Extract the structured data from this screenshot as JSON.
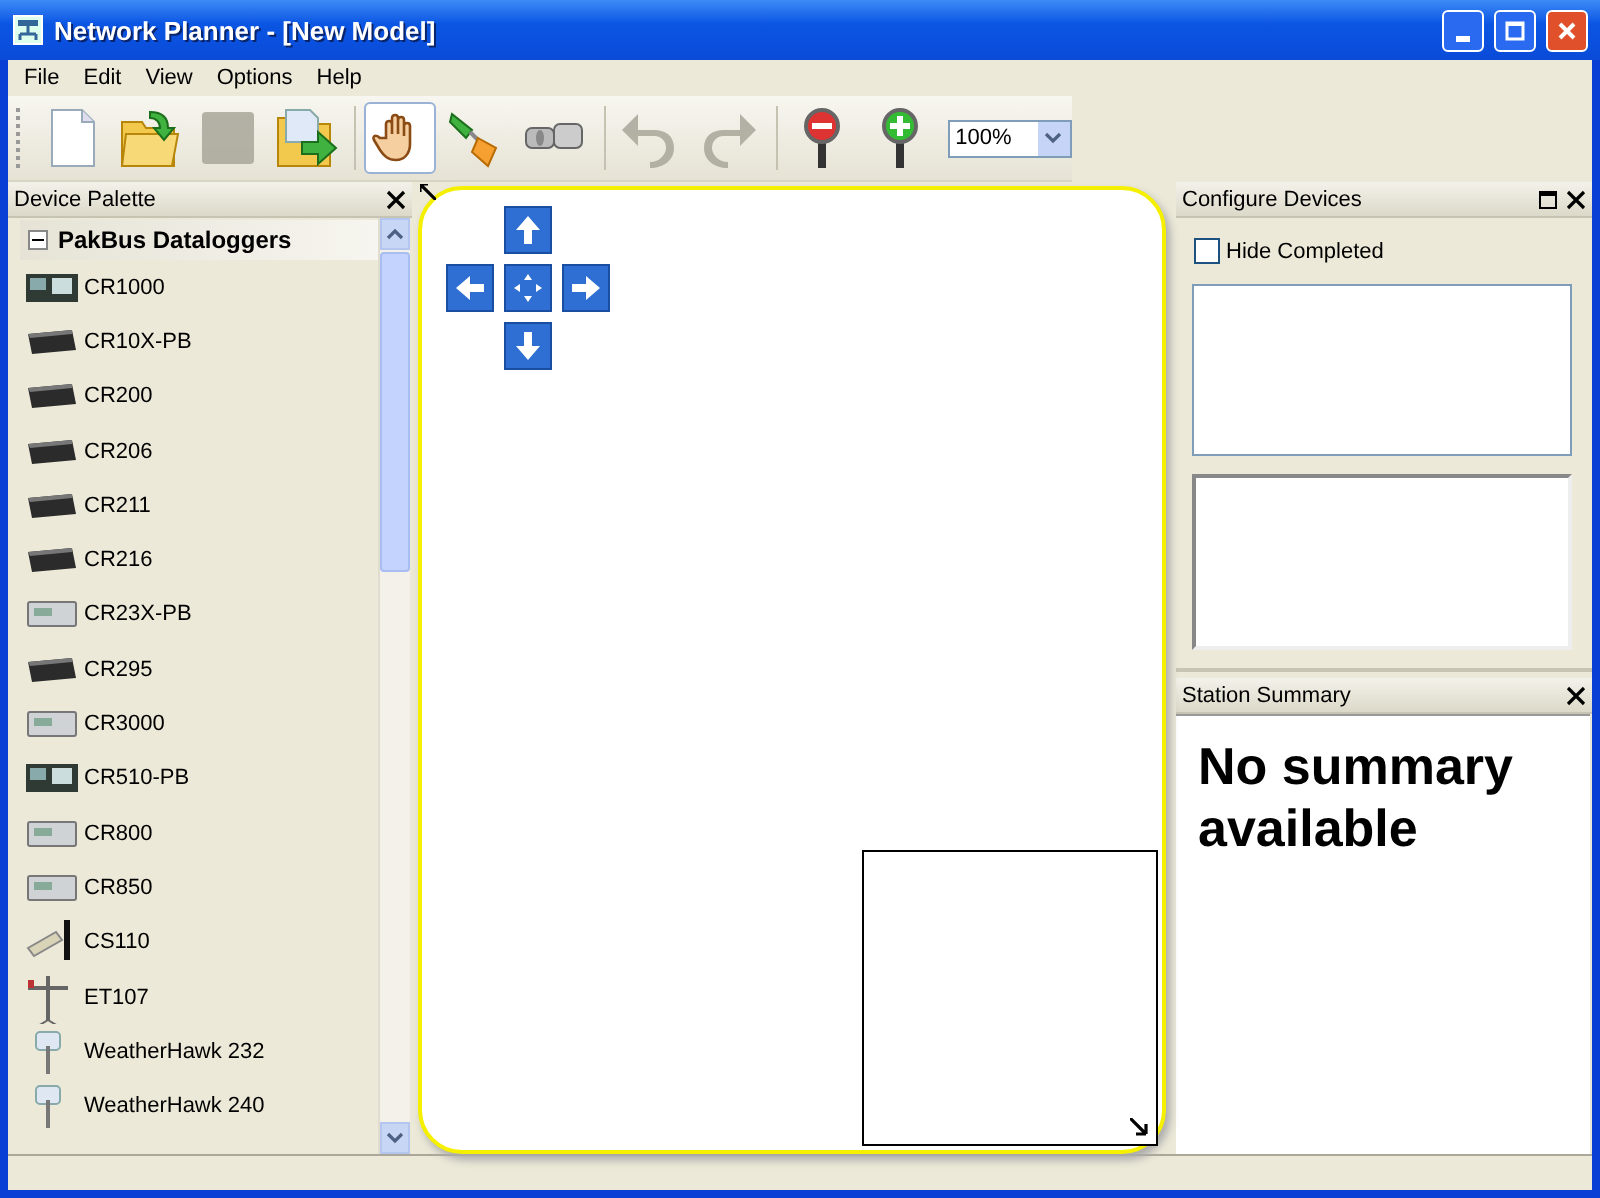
{
  "window": {
    "title": "Network Planner - [New Model]"
  },
  "menu": [
    {
      "label": "File"
    },
    {
      "label": "Edit"
    },
    {
      "label": "View"
    },
    {
      "label": "Options"
    },
    {
      "label": "Help"
    }
  ],
  "toolbar": [
    {
      "kind": "new",
      "selected": false,
      "disabled": false
    },
    {
      "kind": "open",
      "selected": false,
      "disabled": false
    },
    {
      "kind": "save",
      "selected": false,
      "disabled": true
    },
    {
      "kind": "export",
      "selected": false,
      "disabled": false
    },
    {
      "kind": "pan",
      "selected": true,
      "disabled": false
    },
    {
      "kind": "connect",
      "selected": false,
      "disabled": false
    },
    {
      "kind": "link",
      "selected": false,
      "disabled": false
    },
    {
      "kind": "undo",
      "selected": false,
      "disabled": true
    },
    {
      "kind": "redo",
      "selected": false,
      "disabled": true
    },
    {
      "kind": "zoom-out",
      "selected": false,
      "disabled": false
    },
    {
      "kind": "zoom-in",
      "selected": false,
      "disabled": false
    }
  ],
  "zoom": {
    "value": "100%"
  },
  "device_palette": {
    "title": "Device Palette",
    "group": {
      "label": "PakBus Dataloggers",
      "expanded": true,
      "children": [
        {
          "label": "CR1000",
          "kind": "board"
        },
        {
          "label": "CR10X-PB",
          "kind": "logger"
        },
        {
          "label": "CR200",
          "kind": "logger"
        },
        {
          "label": "CR206",
          "kind": "logger"
        },
        {
          "label": "CR211",
          "kind": "logger"
        },
        {
          "label": "CR216",
          "kind": "logger"
        },
        {
          "label": "CR23X-PB",
          "kind": "panel"
        },
        {
          "label": "CR295",
          "kind": "logger"
        },
        {
          "label": "CR3000",
          "kind": "panel"
        },
        {
          "label": "CR510-PB",
          "kind": "board"
        },
        {
          "label": "CR800",
          "kind": "panel"
        },
        {
          "label": "CR850",
          "kind": "panel"
        },
        {
          "label": "CS110",
          "kind": "sensor"
        },
        {
          "label": "ET107",
          "kind": "tripod"
        },
        {
          "label": "WeatherHawk 232",
          "kind": "weather"
        },
        {
          "label": "WeatherHawk 240",
          "kind": "weather"
        }
      ]
    }
  },
  "configure_devices": {
    "title": "Configure Devices",
    "hide_completed": {
      "label": "Hide Completed",
      "checked": false
    }
  },
  "station_summary": {
    "title": "Station Summary",
    "message": "No summary available"
  }
}
